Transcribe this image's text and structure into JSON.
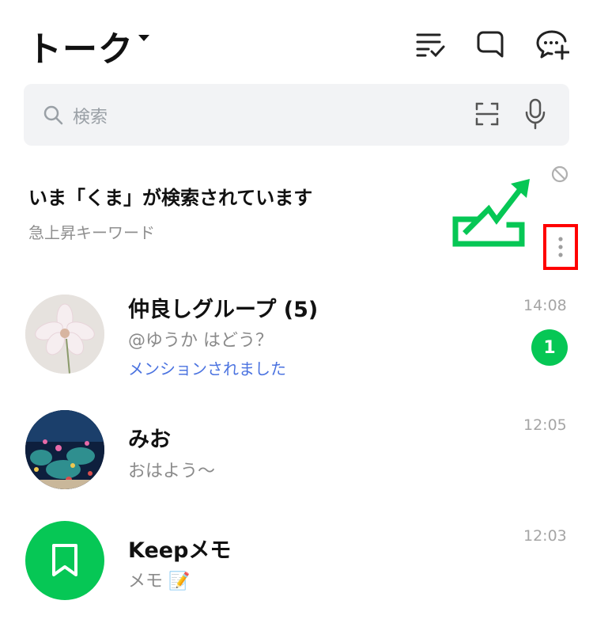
{
  "header": {
    "title": "トーク",
    "icons": [
      "sort-check-icon",
      "openchat-icon",
      "new-chat-icon"
    ]
  },
  "search": {
    "placeholder": "検索",
    "icons": [
      "search-icon",
      "scan-icon",
      "mic-icon"
    ]
  },
  "trending": {
    "title": "いま「くま」が検索されています",
    "subtitle": "急上昇キーワード",
    "icons": [
      "trending-up-icon",
      "hide-icon",
      "more-vertical-icon"
    ],
    "highlight_color": "#ff0000",
    "graphic_color": "#06c755"
  },
  "chats": [
    {
      "name": "仲良しグループ (5)",
      "message": "@ゆうか はどう？",
      "mention": "メンションされました",
      "time": "14:08",
      "unread": "1"
    },
    {
      "name": "みお",
      "message": "おはよう～",
      "time": "12:05"
    },
    {
      "name": "Keepメモ",
      "message": "メモ 📝",
      "time": "12:03"
    }
  ],
  "colors": {
    "accent": "#06c755",
    "mention": "#4b73e0",
    "search_bg": "#f2f3f5"
  }
}
